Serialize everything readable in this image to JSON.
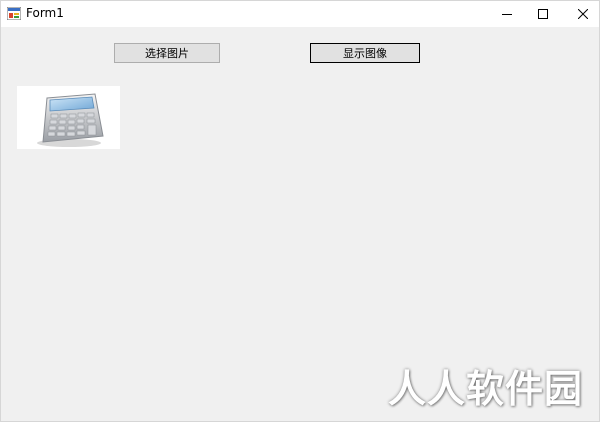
{
  "window": {
    "title": "Form1",
    "icon": "winforms-app-icon"
  },
  "caption_buttons": {
    "minimize": "minimize-icon",
    "maximize": "maximize-icon",
    "close": "close-icon"
  },
  "buttons": {
    "select_image_label": "选择图片",
    "show_image_label": "显示图像"
  },
  "picture": {
    "content": "calculator-icon"
  },
  "watermark": {
    "text": "人人软件园"
  },
  "colors": {
    "form_background": "#f0f0f0",
    "button_face": "#e1e1e1",
    "button_border": "#adadad",
    "titlebar": "#ffffff"
  }
}
